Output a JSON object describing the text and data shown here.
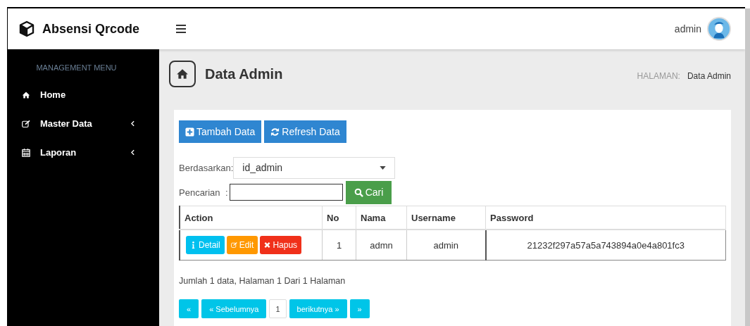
{
  "brand": {
    "title": "Absensi Qrcode"
  },
  "header": {
    "user": "admin"
  },
  "sidebar": {
    "heading": "MANAGEMENT MENU",
    "items": [
      {
        "label": "Home",
        "expandable": false
      },
      {
        "label": "Master Data",
        "expandable": true
      },
      {
        "label": "Laporan",
        "expandable": true
      }
    ]
  },
  "page_header": {
    "title": "Data Admin",
    "breadcrumb_label": "HALAMAN:",
    "breadcrumb_current": "Data Admin"
  },
  "toolbar": [
    {
      "label": "Tambah Data"
    },
    {
      "label": "Refresh Data"
    }
  ],
  "filter": {
    "label": "Berdasarkan",
    "separator": ":",
    "value": "id_admin"
  },
  "search": {
    "label": "Pencarian",
    "separator": ":",
    "button": "Cari"
  },
  "table": {
    "columns": [
      "Action",
      "No",
      "Nama",
      "Username",
      "Password"
    ],
    "rows": [
      {
        "cells": [
          {
            "kind": "actions",
            "buttons": [
              {
                "label": "Detail",
                "color": "#00c0ef"
              },
              {
                "label": "Edit",
                "color": "#ff9800"
              },
              {
                "label": "Hapus",
                "color": "#f0301a"
              }
            ]
          },
          {
            "kind": "text",
            "text": "1"
          },
          {
            "kind": "text",
            "text": "admn"
          },
          {
            "kind": "text",
            "text": "admin"
          },
          {
            "kind": "text",
            "text": "21232f297a57a5a743894a0e4a801fc3"
          }
        ]
      }
    ]
  },
  "summary": "Jumlah 1 data, Halaman 1 Dari 1 Halaman",
  "pagination": [
    {
      "label": "«",
      "selected": false
    },
    {
      "label": "« Sebelumnya",
      "selected": false
    },
    {
      "label": "1",
      "selected": true
    },
    {
      "label": "berikutnya »",
      "selected": false
    },
    {
      "label": "»",
      "selected": false
    }
  ]
}
